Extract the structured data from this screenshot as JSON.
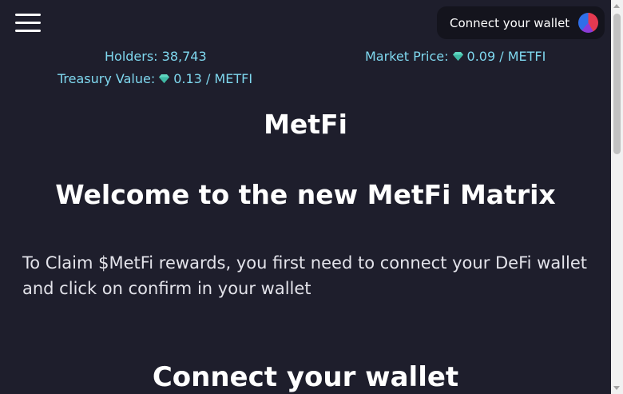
{
  "header": {
    "menu_icon": "hamburger-menu-icon",
    "connect_wallet_label": "Connect your wallet",
    "wallet_icon": "wallet-provider-icon"
  },
  "stats": {
    "holders": "Holders: 38,743",
    "market_price_label": "Market Price:",
    "market_price_value": "0.09 / METFI",
    "treasury_label": "Treasury Value:",
    "treasury_value": "0.13 / METFI",
    "token_icon": "diamond-icon"
  },
  "main": {
    "brand": "MetFi",
    "welcome": "Welcome to the new MetFi Matrix",
    "intro": "To Claim $MetFi rewards, you first need to connect your DeFi wallet and click on confirm in your wallet",
    "connect_heading": "Connect your wallet"
  },
  "colors": {
    "background": "#1e1e2c",
    "accent_text": "#7fd8ef",
    "button_bg": "#14141d",
    "gem": "#5fd6c0"
  }
}
